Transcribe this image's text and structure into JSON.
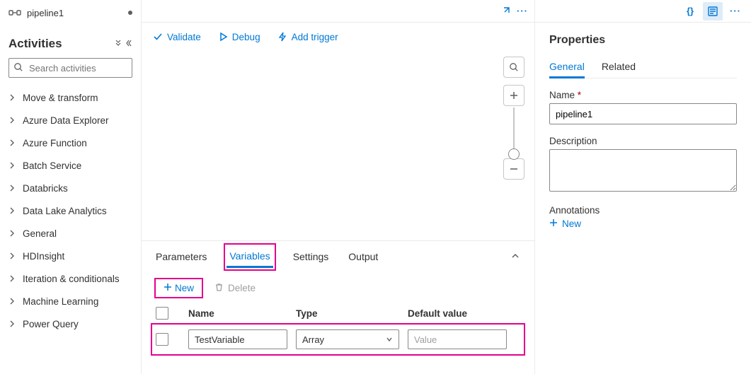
{
  "tab": {
    "title": "pipeline1"
  },
  "sidebar": {
    "heading": "Activities",
    "search_placeholder": "Search activities",
    "categories": [
      "Move & transform",
      "Azure Data Explorer",
      "Azure Function",
      "Batch Service",
      "Databricks",
      "Data Lake Analytics",
      "General",
      "HDInsight",
      "Iteration & conditionals",
      "Machine Learning",
      "Power Query"
    ]
  },
  "toolbar": {
    "validate": "Validate",
    "debug": "Debug",
    "add_trigger": "Add trigger"
  },
  "bottom": {
    "tabs": {
      "parameters": "Parameters",
      "variables": "Variables",
      "settings": "Settings",
      "output": "Output"
    },
    "active_tab": "variables",
    "actions": {
      "new": "New",
      "delete": "Delete"
    },
    "columns": {
      "name": "Name",
      "type": "Type",
      "default": "Default value"
    },
    "rows": [
      {
        "name": "TestVariable",
        "type": "Array",
        "default_placeholder": "Value"
      }
    ]
  },
  "properties": {
    "title": "Properties",
    "tabs": {
      "general": "General",
      "related": "Related"
    },
    "name_label": "Name",
    "name_value": "pipeline1",
    "description_label": "Description",
    "description_value": "",
    "annotations_label": "Annotations",
    "ann_new": "New"
  }
}
